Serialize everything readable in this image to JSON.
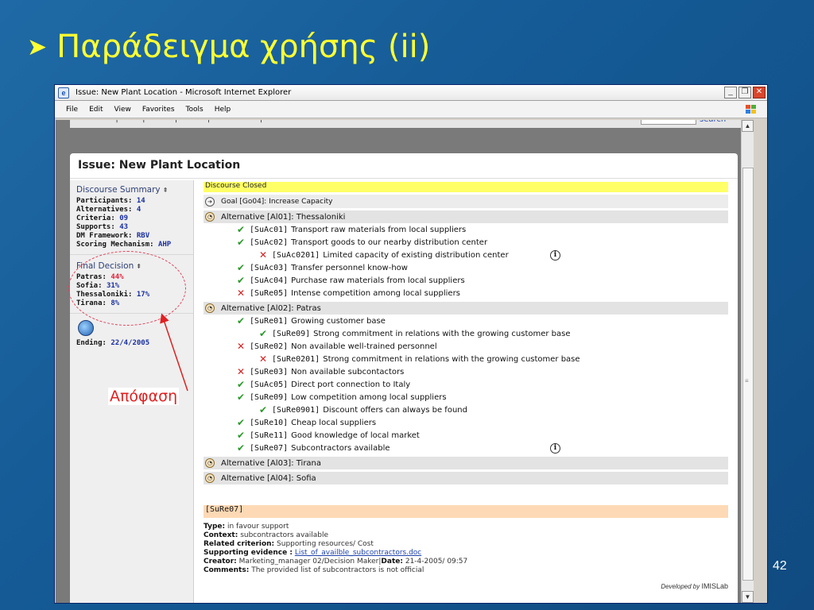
{
  "slide": {
    "title": "Παράδειγμα χρήσης (ii)",
    "bullet": "➤",
    "page_number": "42",
    "annotation_label": "Απόφαση"
  },
  "window": {
    "title": "Issue: New Plant Location - Microsoft Internet Explorer",
    "menu": [
      "File",
      "Edit",
      "View",
      "Favorites",
      "Tools",
      "Help"
    ]
  },
  "topnav": {
    "search_link": "search"
  },
  "page": {
    "heading": "Issue: New Plant Location",
    "discourse_summary": {
      "title": "Discourse Summary",
      "items": [
        {
          "k": "Participants:",
          "v": "14"
        },
        {
          "k": "Alternatives:",
          "v": "4"
        },
        {
          "k": "Criteria:",
          "v": "09"
        },
        {
          "k": "Supports:",
          "v": "43"
        },
        {
          "k": "DM Framework:",
          "v": "RBV"
        },
        {
          "k": "Scoring Mechanism:",
          "v": "AHP"
        }
      ]
    },
    "final_decision": {
      "title": "Final Decision",
      "items": [
        {
          "k": "Patras:",
          "v": "44%",
          "highlight": true
        },
        {
          "k": "Sofia:",
          "v": "31%"
        },
        {
          "k": "Thessaloniki:",
          "v": "17%"
        },
        {
          "k": "Tirana:",
          "v": "8%"
        }
      ]
    },
    "ending": {
      "k": "Ending:",
      "v": "22/4/2005"
    },
    "discourse_closed": "Discourse Closed",
    "goal": "Goal [Go04]: Increase Capacity",
    "alternatives": [
      {
        "label": "Alternative [Al01]: Thessaloniki",
        "args": [
          {
            "mark": "check",
            "indent": 0,
            "id": "[SuAc01]",
            "text": "Transport raw materials from local suppliers"
          },
          {
            "mark": "check",
            "indent": 0,
            "id": "[SuAc02]",
            "text": "Transport goods to our nearby distribution center"
          },
          {
            "mark": "cross",
            "indent": 1,
            "id": "[SuAc0201]",
            "text": "Limited capacity of existing distribution center",
            "info": true
          },
          {
            "mark": "check",
            "indent": 0,
            "id": "[SuAc03]",
            "text": "Transfer personnel know-how"
          },
          {
            "mark": "check",
            "indent": 0,
            "id": "[SuAc04]",
            "text": "Purchase raw materials from local suppliers"
          },
          {
            "mark": "cross",
            "indent": 0,
            "id": "[SuRe05]",
            "text": "Intense competition among local suppliers"
          }
        ]
      },
      {
        "label": "Alternative [Al02]: Patras",
        "args": [
          {
            "mark": "check",
            "indent": 0,
            "id": "[SuRe01]",
            "text": "Growing customer base"
          },
          {
            "mark": "check",
            "indent": 1,
            "id": "[SuRe09]",
            "text": "Strong commitment in relations with the growing customer base"
          },
          {
            "mark": "cross",
            "indent": 0,
            "id": "[SuRe02]",
            "text": "Non available well-trained personnel"
          },
          {
            "mark": "cross",
            "indent": 1,
            "id": "[SuRe0201]",
            "text": "Strong commitment in relations with the growing customer base"
          },
          {
            "mark": "cross",
            "indent": 0,
            "id": "[SuRe03]",
            "text": "Non available subcontactors"
          },
          {
            "mark": "check",
            "indent": 0,
            "id": "[SuAc05]",
            "text": "Direct port connection to Italy"
          },
          {
            "mark": "check",
            "indent": 0,
            "id": "[SuRe09]",
            "text": "Low competition among local suppliers"
          },
          {
            "mark": "check",
            "indent": 1,
            "id": "[SuRe0901]",
            "text": "Discount offers can always be found"
          },
          {
            "mark": "check",
            "indent": 0,
            "id": "[SuRe10]",
            "text": "Cheap local suppliers"
          },
          {
            "mark": "check",
            "indent": 0,
            "id": "[SuRe11]",
            "text": "Good knowledge of local market"
          },
          {
            "mark": "check",
            "indent": 0,
            "id": "[SuRe07]",
            "text": "Subcontractors available",
            "info": true
          }
        ]
      },
      {
        "label": "Alternative [Al03]: Tirana",
        "args": []
      },
      {
        "label": "Alternative [Al04]: Sofia",
        "args": []
      }
    ],
    "detail": {
      "header": "[SuRe07]",
      "type_label": "Type:",
      "type_value": "in favour support",
      "context_label": "Context:",
      "context_value": "subcontractors available",
      "criterion_label": "Related criterion:",
      "criterion_value": "Supporting resources/ Cost",
      "evidence_label": "Supporting evidence :",
      "evidence_value": "List_of_availble_subcontractors.doc",
      "creator_label": "Creator:",
      "creator_value": "Marketing_manager 02/Decision Maker|",
      "date_label": "Date:",
      "date_value": "21-4-2005/ 09:57",
      "comments_label": "Comments:",
      "comments_value": "The provided list of subcontractors is not official"
    },
    "developed_by": "Developed by",
    "brand": "IMISLab"
  },
  "colors": {
    "slide_bg": "#155b96",
    "title_yellow": "#ffff33",
    "closed_bar": "#ffff66",
    "detail_header": "#fdd9b5",
    "annotation_red": "#e02020"
  }
}
